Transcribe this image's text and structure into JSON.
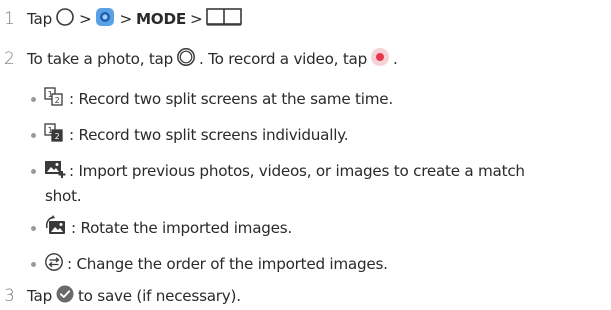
{
  "steps": [
    {
      "number": "1",
      "tap": "Tap",
      "sep": ">",
      "mode": "MODE"
    },
    {
      "number": "2",
      "text_a": "To take a photo, tap",
      "text_b": ". To record a video, tap",
      "text_c": ".",
      "bullets": [
        {
          "icon": "split-same-time-icon",
          "text": ": Record two split screens at the same time."
        },
        {
          "icon": "split-individual-icon",
          "text": ": Record two split screens individually."
        },
        {
          "icon": "import-image-icon",
          "text": ": Import previous photos, videos, or images to create a match",
          "text_cont": "shot."
        },
        {
          "icon": "rotate-image-icon",
          "text": ": Rotate the imported images."
        },
        {
          "icon": "swap-order-icon",
          "text": ": Change the order of the imported images."
        }
      ]
    },
    {
      "number": "3",
      "text_a": "Tap",
      "text_b": "to save (if necessary)."
    }
  ],
  "colors": {
    "text": "#2b2b2b",
    "step_number": "#7a7a7a",
    "record_red": "#e8354a",
    "camera_blue": "#3a86d8",
    "check_grey": "#6a6a6a"
  }
}
